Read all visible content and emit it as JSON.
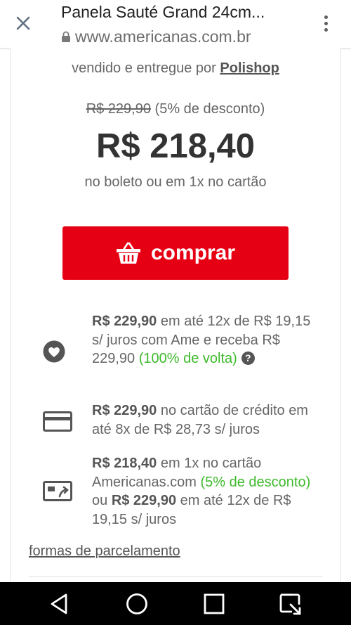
{
  "browser": {
    "title": "Panela Sauté Grand 24cm...",
    "url": "www.americanas.com.br",
    "icons": {
      "close": "close-icon",
      "lock": "lock-icon",
      "menu": "more-vert-icon"
    }
  },
  "product": {
    "seller_prefix": "vendido e entregue por",
    "seller_name": "Polishop",
    "old_price": "R$ 229,90",
    "discount_note": "(5% de desconto)",
    "price": "R$ 218,40",
    "price_note": "no boleto ou em 1x no cartão",
    "buy_label": "comprar"
  },
  "payments": {
    "ame": {
      "icon": "ame-heart-icon",
      "amount": "R$ 229,90",
      "text1": " em até 12x de R$ 19,15 s/ juros com Ame e receba R$ 229,90 ",
      "cashback": "(100% de volta)",
      "help": "?"
    },
    "credit": {
      "icon": "credit-card-icon",
      "amount": "R$ 229,90",
      "text1": " no cartão de crédito em até 8x de R$ 28,73 s/ juros"
    },
    "store_card": {
      "icon": "store-card-icon",
      "amount": "R$ 218,40",
      "text1": " em 1x no cartão Americanas.com ",
      "discount": "(5% de desconto)",
      "text2": " ou ",
      "amount2": "R$ 229,90",
      "text3": " em até 12x de R$ 19,15 s/ juros"
    },
    "installments_link": "formas de parcelamento"
  },
  "navbar": {
    "icons": [
      "back-icon",
      "home-icon",
      "recents-icon",
      "screenshot-icon"
    ]
  },
  "colors": {
    "accent": "#e60014",
    "green": "#3dba2b",
    "text": "#666666"
  }
}
